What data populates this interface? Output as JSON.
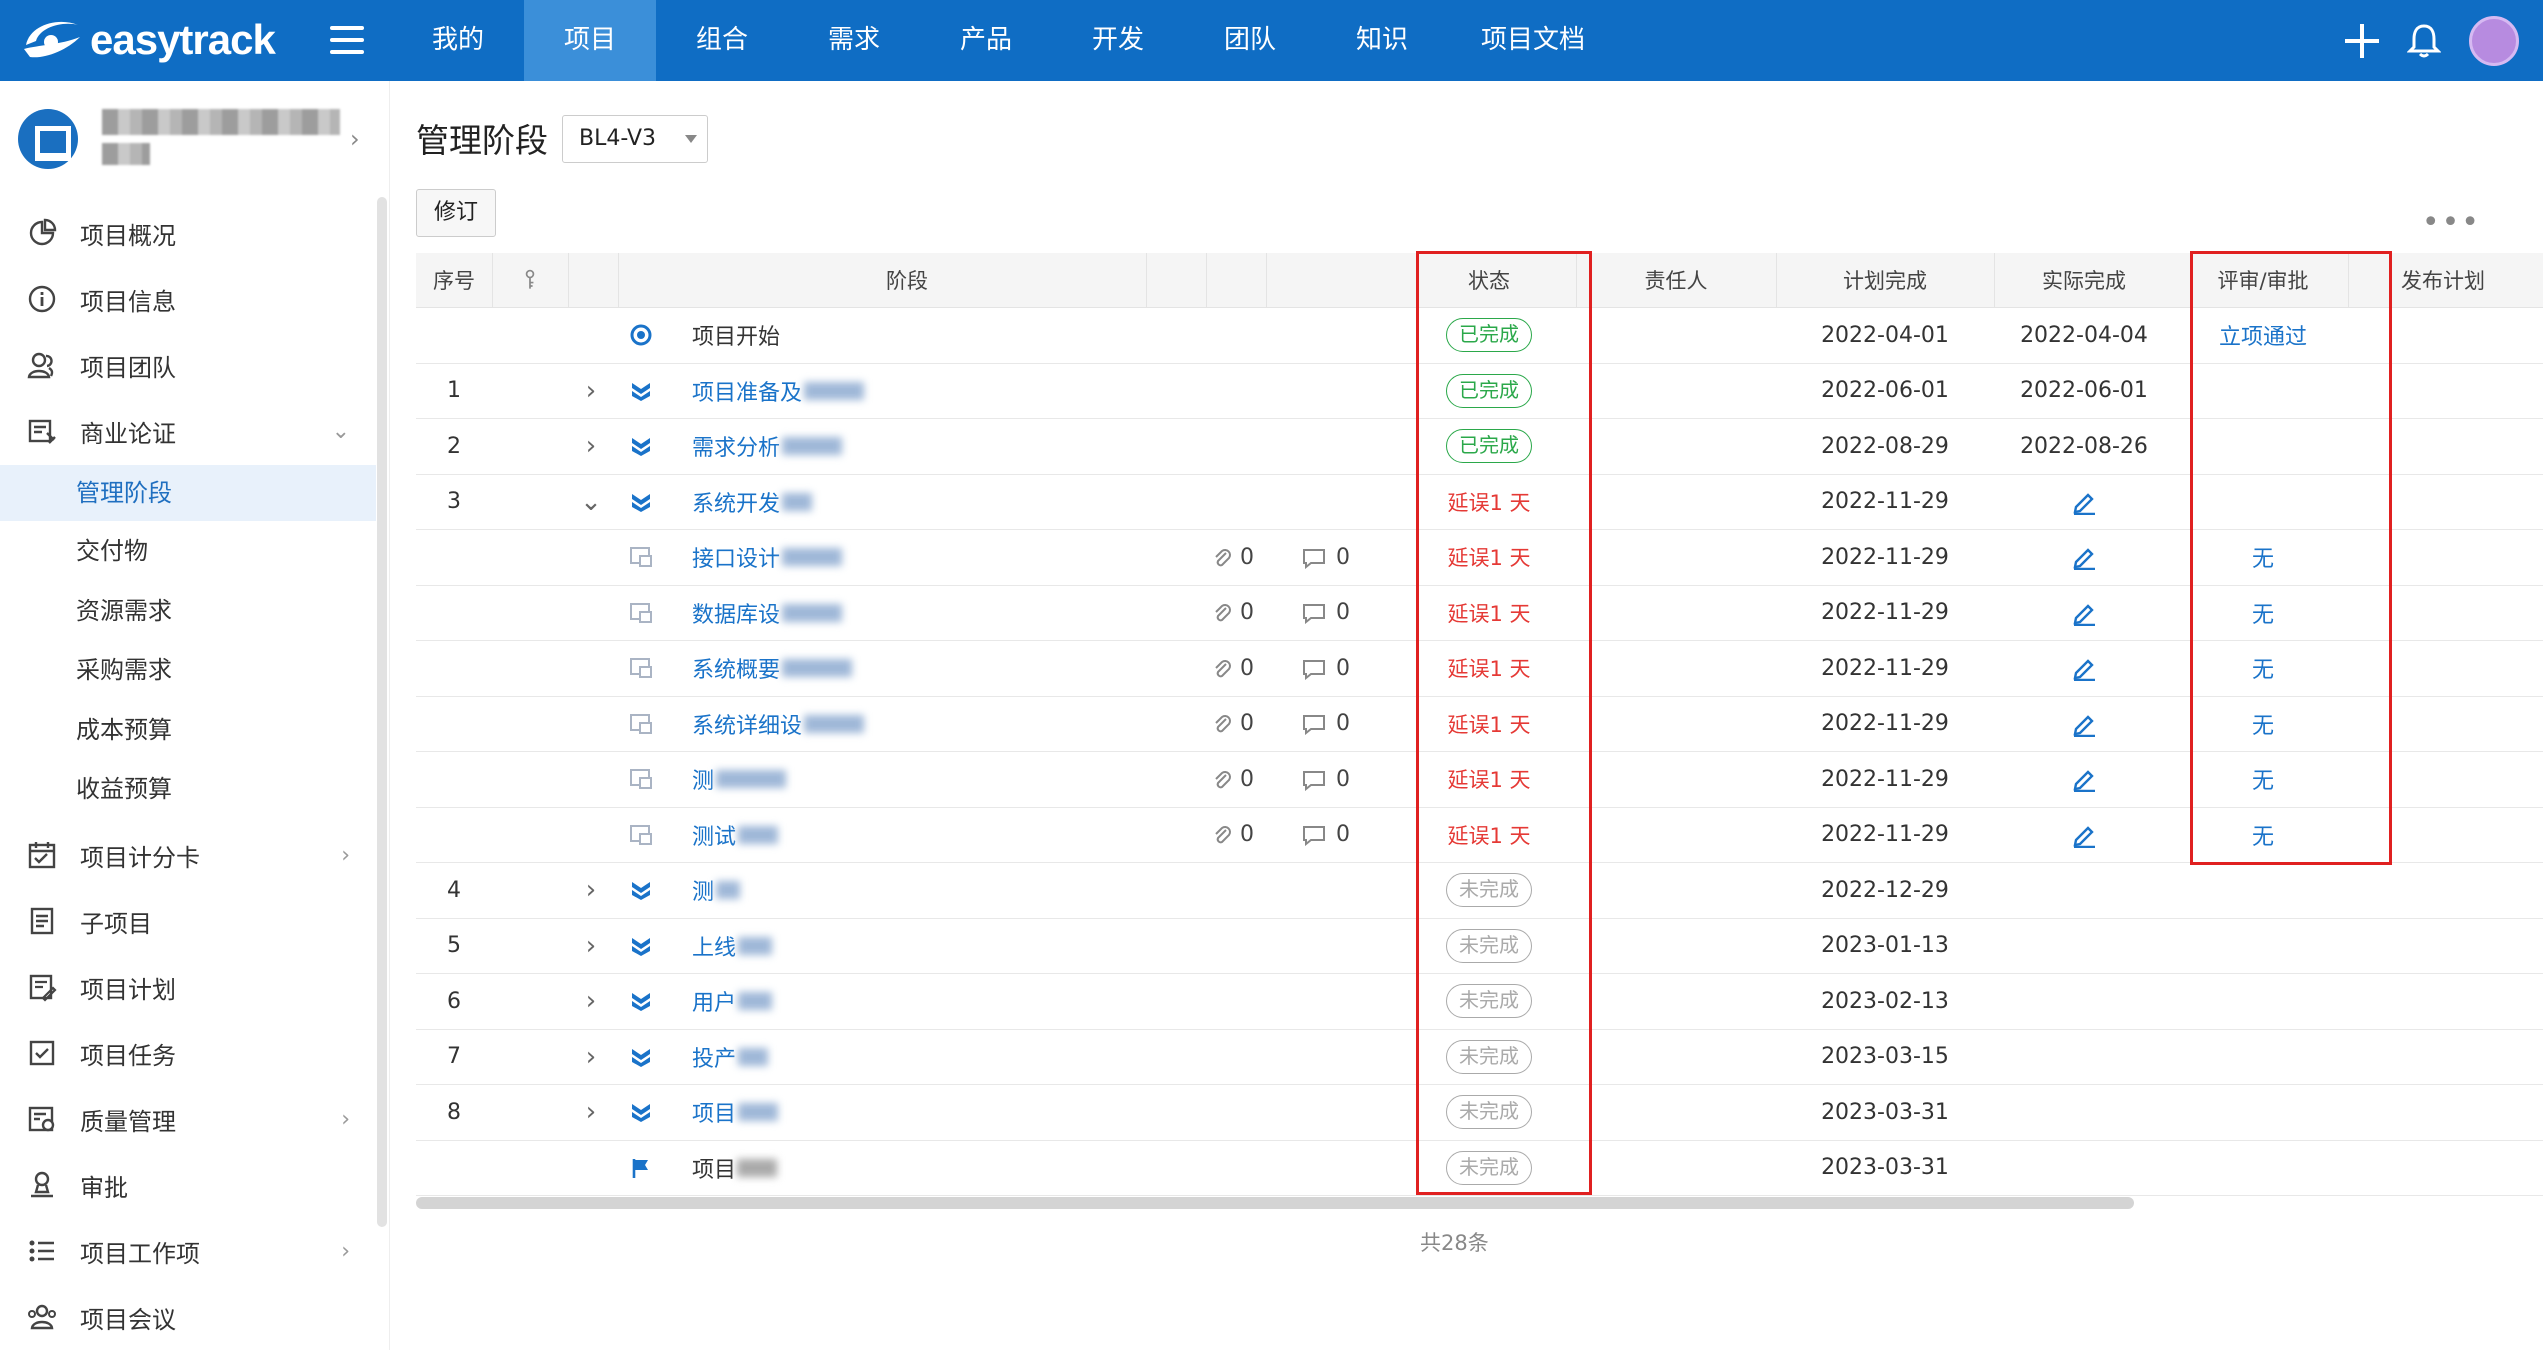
{
  "app": {
    "logo_text": "easytrack",
    "nav": [
      "我的",
      "项目",
      "组合",
      "需求",
      "产品",
      "开发",
      "团队",
      "知识",
      "项目文档"
    ],
    "active_nav_index": 1
  },
  "sidebar": {
    "items": [
      {
        "label": "项目概况",
        "icon": "pie-chart-icon"
      },
      {
        "label": "项目信息",
        "icon": "info-icon"
      },
      {
        "label": "项目团队",
        "icon": "team-icon"
      },
      {
        "label": "商业论证",
        "icon": "case-icon",
        "expanded": true
      },
      {
        "label": "项目计分卡",
        "icon": "scorecard-icon"
      },
      {
        "label": "子项目",
        "icon": "subproject-icon"
      },
      {
        "label": "项目计划",
        "icon": "plan-icon"
      },
      {
        "label": "项目任务",
        "icon": "task-icon"
      },
      {
        "label": "质量管理",
        "icon": "quality-icon"
      },
      {
        "label": "审批",
        "icon": "approval-icon"
      },
      {
        "label": "项目工作项",
        "icon": "workitem-icon"
      },
      {
        "label": "项目会议",
        "icon": "meeting-icon"
      }
    ],
    "sub_items": [
      "管理阶段",
      "交付物",
      "资源需求",
      "采购需求",
      "成本预算",
      "收益预算"
    ],
    "active_sub": "管理阶段"
  },
  "page": {
    "title": "管理阶段",
    "version": "BL4-V3",
    "revise_label": "修订",
    "more_label": "•••",
    "total_label": "共28条"
  },
  "table": {
    "headers": {
      "seq": "序号",
      "stage": "阶段",
      "status": "状态",
      "owner": "责任人",
      "plan": "计划完成",
      "actual": "实际完成",
      "review": "评审/审批",
      "release": "发布计划"
    },
    "rows": [
      {
        "seq": "",
        "icon": "milestone-start",
        "name": "项目开始",
        "status": "已完成",
        "status_type": "done",
        "plan": "2022-04-01",
        "actual": "2022-04-04",
        "review": "立项通过"
      },
      {
        "seq": "1",
        "expand": ">",
        "icon": "stage",
        "name": "项目准备及",
        "status": "已完成",
        "status_type": "done",
        "plan": "2022-06-01",
        "actual": "2022-06-01"
      },
      {
        "seq": "2",
        "expand": ">",
        "icon": "stage",
        "name": "需求分析",
        "status": "已完成",
        "status_type": "done",
        "plan": "2022-08-29",
        "actual": "2022-08-26"
      },
      {
        "seq": "3",
        "expand": "v",
        "icon": "stage",
        "name": "系统开发",
        "status": "延误1 天",
        "status_type": "delay",
        "plan": "2022-11-29",
        "actual_edit": true
      },
      {
        "seq": "",
        "icon": "task",
        "name": "接口设计",
        "link": "0",
        "comment": "0",
        "status": "延误1 天",
        "status_type": "delay",
        "plan": "2022-11-29",
        "actual_edit": true,
        "review": "无"
      },
      {
        "seq": "",
        "icon": "task",
        "name": "数据库设",
        "link": "0",
        "comment": "0",
        "status": "延误1 天",
        "status_type": "delay",
        "plan": "2022-11-29",
        "actual_edit": true,
        "review": "无"
      },
      {
        "seq": "",
        "icon": "task",
        "name": "系统概要",
        "link": "0",
        "comment": "0",
        "status": "延误1 天",
        "status_type": "delay",
        "plan": "2022-11-29",
        "actual_edit": true,
        "review": "无"
      },
      {
        "seq": "",
        "icon": "task",
        "name": "系统详细设",
        "link": "0",
        "comment": "0",
        "status": "延误1 天",
        "status_type": "delay",
        "plan": "2022-11-29",
        "actual_edit": true,
        "review": "无"
      },
      {
        "seq": "",
        "icon": "task",
        "name": "测",
        "link": "0",
        "comment": "0",
        "status": "延误1 天",
        "status_type": "delay",
        "plan": "2022-11-29",
        "actual_edit": true,
        "review": "无"
      },
      {
        "seq": "",
        "icon": "task",
        "name": "测试",
        "link": "0",
        "comment": "0",
        "status": "延误1 天",
        "status_type": "delay",
        "plan": "2022-11-29",
        "actual_edit": true,
        "review": "无"
      },
      {
        "seq": "4",
        "expand": ">",
        "icon": "stage",
        "name": "测",
        "status": "未完成",
        "status_type": "todo",
        "plan": "2022-12-29"
      },
      {
        "seq": "5",
        "expand": ">",
        "icon": "stage",
        "name": "上线",
        "status": "未完成",
        "status_type": "todo",
        "plan": "2023-01-13"
      },
      {
        "seq": "6",
        "expand": ">",
        "icon": "stage",
        "name": "用户",
        "status": "未完成",
        "status_type": "todo",
        "plan": "2023-02-13"
      },
      {
        "seq": "7",
        "expand": ">",
        "icon": "stage",
        "name": "投产",
        "status": "未完成",
        "status_type": "todo",
        "plan": "2023-03-15"
      },
      {
        "seq": "8",
        "expand": ">",
        "icon": "stage",
        "name": "项目",
        "status": "未完成",
        "status_type": "todo",
        "plan": "2023-03-31"
      },
      {
        "seq": "",
        "icon": "milestone-end",
        "name": "项目",
        "status": "未完成",
        "status_type": "todo",
        "plan": "2023-03-31"
      }
    ]
  },
  "colors": {
    "brand": "#0f6dc4",
    "active_nav": "#3b8fd9",
    "link": "#1a73c9",
    "done": "#2ba84a",
    "delay": "#e53935",
    "highlight": "#e02020"
  }
}
